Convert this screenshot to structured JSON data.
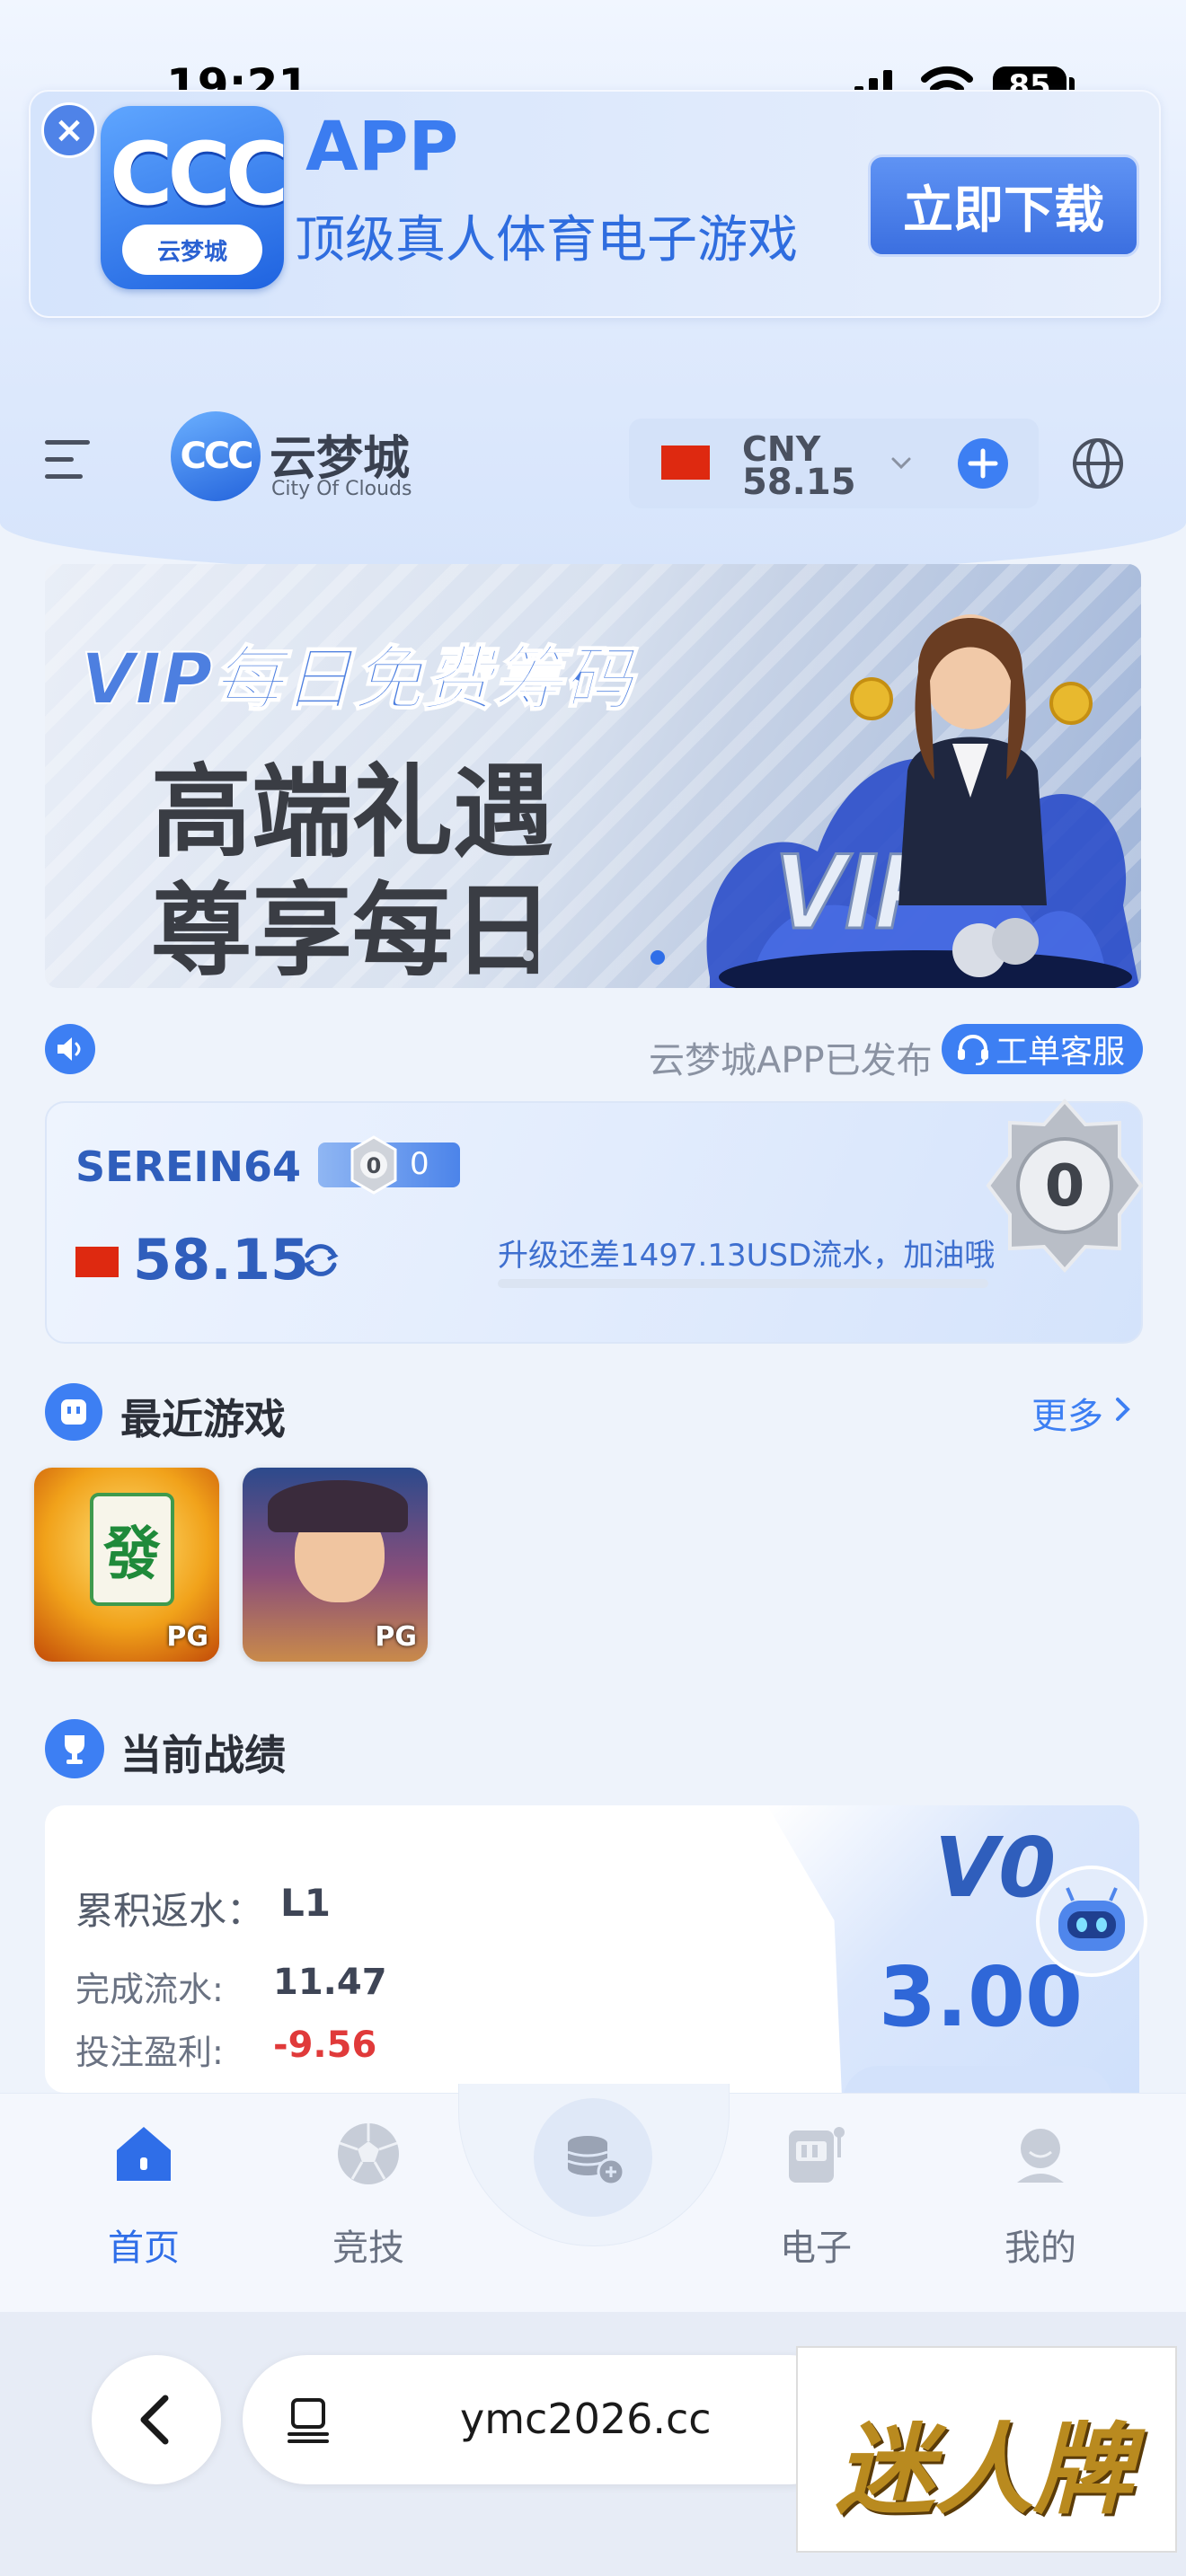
{
  "status_bar": {
    "time": "19:21",
    "battery": "85"
  },
  "app_banner": {
    "icon_text": "CCC",
    "icon_subtitle": "云梦城",
    "title": "APP",
    "subtitle": "顶级真人体育电子游戏",
    "download_label": "立即下载",
    "close_icon": "close-icon"
  },
  "header": {
    "logo_badge": "CCC",
    "logo_name": "云梦城",
    "logo_sub": "City Of Clouds",
    "currency": "CNY",
    "amount": "58.15",
    "icons": [
      "menu-icon",
      "chevron-down-icon",
      "plus-icon",
      "globe-icon"
    ]
  },
  "promo": {
    "line1": "VIP每日免费筹码",
    "line2": "高端礼遇",
    "line3": "尊享每日",
    "splash_text": "VIP",
    "colors": {
      "accent": "#3d7ff3",
      "text_dark": "#3a3d44"
    }
  },
  "notice": {
    "text": "云梦城APP已发布",
    "support_label": "工单客服"
  },
  "user_card": {
    "username": "SEREIN64",
    "vip_badge_level": "0",
    "vip_badge_count": "0",
    "balance": "58.15",
    "upgrade_text": "升级还差1497.13USD流水，加油哦",
    "upgrade_progress": 0,
    "level": "0"
  },
  "recent_games": {
    "title": "最近游戏",
    "more_label": "更多",
    "games": [
      {
        "provider": "PG",
        "tile_glyph": "發"
      },
      {
        "provider": "PG"
      }
    ]
  },
  "record": {
    "title": "当前战绩",
    "rebate_label": "累积返水：",
    "rebate_value": "L1",
    "flow_label": "完成流水:",
    "flow_value": "11.47",
    "profit_label": "投注盈利:",
    "profit_value": "-9.56",
    "vip_level": "V0",
    "amount": "3.00"
  },
  "tabbar": {
    "tabs": [
      {
        "label": "首页",
        "icon": "home-icon",
        "active": true
      },
      {
        "label": "竞技",
        "icon": "soccer-ball-icon",
        "active": false
      },
      {
        "label": "",
        "icon": "coins-icon",
        "active": false
      },
      {
        "label": "电子",
        "icon": "slot-machine-icon",
        "active": false
      },
      {
        "label": "我的",
        "icon": "profile-icon",
        "active": false
      }
    ]
  },
  "browser": {
    "url": "ymc2026.cc"
  },
  "watermark": "迷人牌"
}
